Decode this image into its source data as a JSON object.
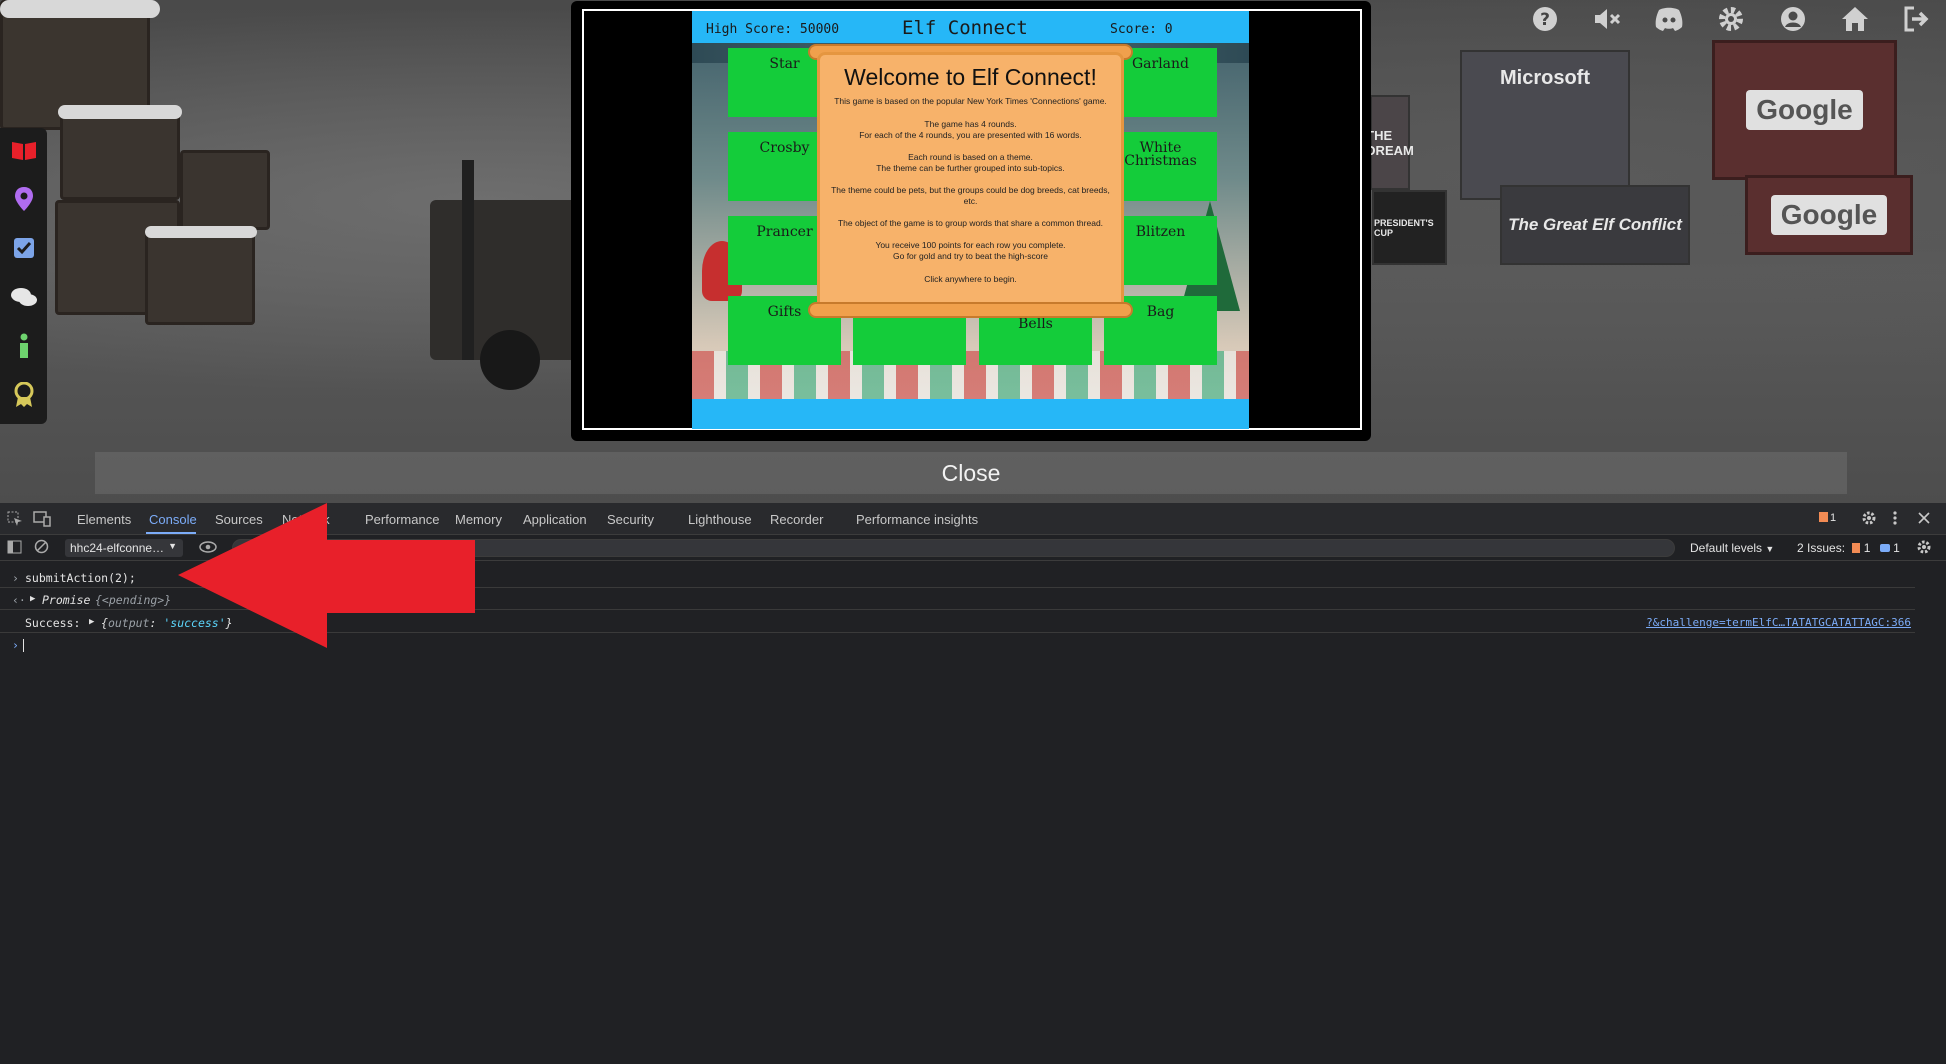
{
  "game_modal": {
    "high_score_label": "High Score: 50000",
    "title": "Elf Connect",
    "score_label": "Score: 0",
    "tiles": [
      "Star",
      "Garland",
      "Crosby",
      "White Christmas",
      "Prancer",
      "Blitzen",
      "Gifts",
      "Bells",
      "Bag"
    ],
    "welcome": {
      "heading": "Welcome to Elf Connect!",
      "lines": [
        "This game is based on the popular New York Times 'Connections' game.",
        "The game has 4 rounds.",
        "For each of the 4 rounds, you are presented with 16 words.",
        "Each round is based on a theme.",
        "The theme can be further grouped into sub-topics.",
        "The theme could be pets, but the groups could be dog breeds, cat breeds, etc.",
        "The object of the game is to group words that share a common thread.",
        "You receive 100 points for each row you complete.",
        "Go for gold and try to beat the high-score",
        "Click anywhere to begin."
      ]
    },
    "close_label": "Close"
  },
  "world_signs": {
    "microsoft": "Microsoft",
    "google_1": "Google",
    "google_2": "Google",
    "elf_conflict": "The Great Elf Conflict",
    "presidents_cup": "PRESIDENT'S CUP",
    "dream": "THE DREAM"
  },
  "game_sidebar": {
    "icons": [
      "book-icon",
      "map-pin-icon",
      "checklist-icon",
      "chat-icon",
      "info-icon",
      "award-icon"
    ]
  },
  "top_toolbar": {
    "icons": [
      "help-icon",
      "mute-icon",
      "discord-icon",
      "settings-icon",
      "account-icon",
      "home-icon",
      "logout-icon"
    ]
  },
  "devtools": {
    "tabs": [
      "Elements",
      "Console",
      "Sources",
      "Network",
      "Performance",
      "Memory",
      "Application",
      "Security",
      "Lighthouse",
      "Recorder",
      "Performance insights"
    ],
    "active_tab": "Console",
    "issues_count_badge": "1",
    "context_selector": "hhc24-elfconne…",
    "default_levels": "Default levels",
    "issues_summary": "2 Issues:",
    "issues_warn": "1",
    "issues_info": "1",
    "console": {
      "command": "submitAction(2);",
      "promise_label": "Promise",
      "promise_state": "{<pending>}",
      "success_prefix": "Success:",
      "success_obj_key": "output",
      "success_obj_val": "'success'",
      "source_link": "?&challenge=termElfC…TATATGCATATTAGC:366"
    }
  },
  "colors": {
    "game_header_bg": "#26b7f7",
    "tile_green": "#14cc3a",
    "scroll_orange": "#f7b26a",
    "devtools_bg": "#202124",
    "link_blue": "#7cacf8",
    "arrow_red": "#e8202a"
  }
}
